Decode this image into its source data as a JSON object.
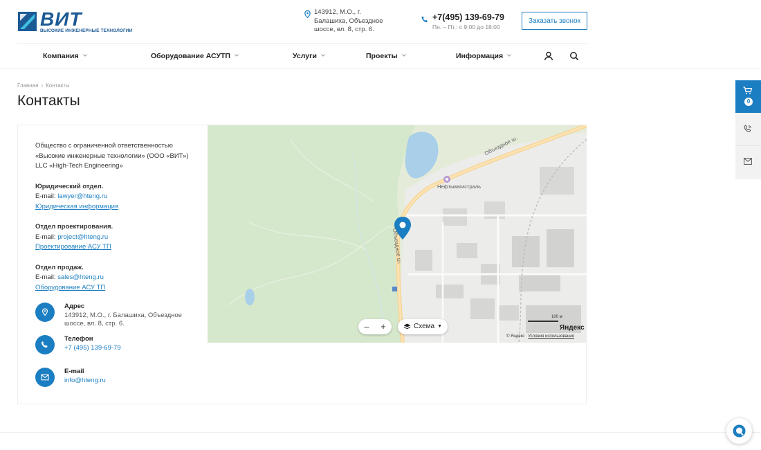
{
  "header": {
    "logo_text": "ВИТ",
    "logo_subtitle": "ВЫСОКИЕ ИНЖЕНЕРНЫЕ ТЕХНОЛОГИИ",
    "address": "143912, М.О., г. Балашиха, Объездное шоссе, вл. 8, стр. 6.",
    "phone": "+7(495) 139-69-79",
    "hours": "Пн. – Пт.: с 9:00 до 18:00",
    "callback_label": "Заказать звонок"
  },
  "nav": {
    "items": [
      {
        "label": "Компания"
      },
      {
        "label": "Оборудование АСУТП"
      },
      {
        "label": "Услуги"
      },
      {
        "label": "Проекты"
      },
      {
        "label": "Информация"
      }
    ]
  },
  "breadcrumb": {
    "home": "Главная",
    "current": "Контакты"
  },
  "page": {
    "title": "Контакты"
  },
  "company": {
    "line1": "Общество с ограниченной ответственностью «Высокие инженерные технологии» (ООО «ВИТ»)",
    "line2": "LLC «High-Tech Engineering»"
  },
  "departments": [
    {
      "title": "Юридический отдел.",
      "email_label": "E-mail: ",
      "email": "lawyer@hteng.ru",
      "link": "Юридическая информация"
    },
    {
      "title": "Отдел проектирования.",
      "email_label": "E-mail: ",
      "email": "project@hteng.ru",
      "link": "Проектирование АСУ ТП"
    },
    {
      "title": "Отдел продаж.",
      "email_label": "E-mail: ",
      "email": "sales@hteng.ru",
      "link": "Оборудование АСУ ТП"
    }
  ],
  "contacts": {
    "address_label": "Адрес",
    "address_value": "143912, М.О., г. Балашиха, Объездное шоссе, вл. 8, стр. 6.",
    "phone_label": "Телефон",
    "phone_value": "+7 (495) 139-69-79",
    "email_label": "E-mail",
    "email_value": "info@hteng.ru"
  },
  "map": {
    "zoom_out": "–",
    "zoom_in": "+",
    "layer_label": "Схема",
    "scale_label": "100 м",
    "brand": "Яндекс",
    "copyright": "© Яндекс",
    "terms": "Условия использования",
    "poi": "Нефтьмагистраль",
    "road_1": "Объездное ш.",
    "road_2": "Объездное ш."
  },
  "side": {
    "cart_count": "0"
  },
  "colors": {
    "accent": "#1b7ec2",
    "brand": "#1c5a95"
  }
}
